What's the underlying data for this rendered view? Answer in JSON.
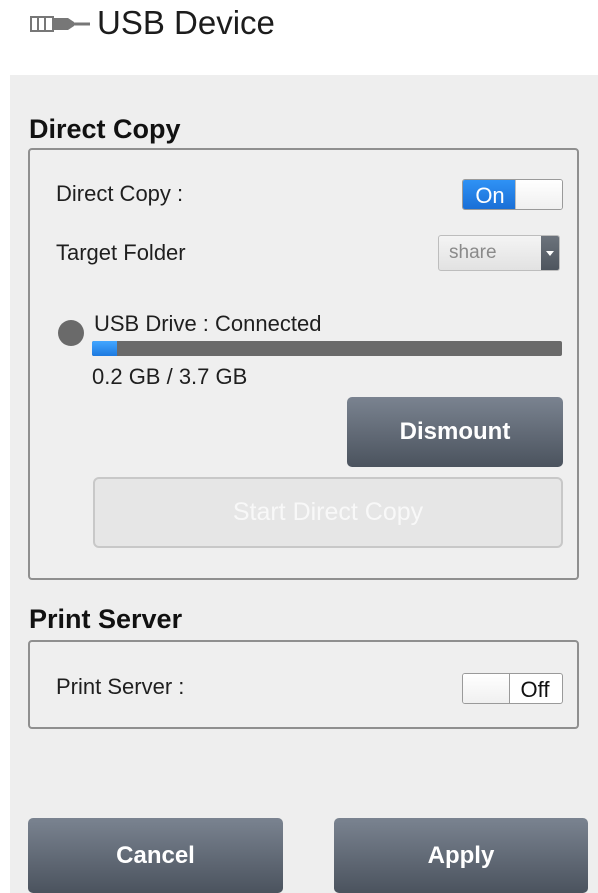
{
  "header": {
    "title": "USB Device",
    "icon": "usb-plug-icon"
  },
  "direct_copy": {
    "section_title": "Direct Copy",
    "toggle_label": "Direct Copy :",
    "toggle_state": "On",
    "target_folder_label": "Target Folder",
    "target_folder_value": "share",
    "usb_status": "USB Drive : Connected",
    "usage_text": "0.2 GB / 3.7 GB",
    "usage_fraction": 0.054,
    "dismount_label": "Dismount",
    "start_copy_label": "Start Direct Copy"
  },
  "print_server": {
    "section_title": "Print Server",
    "toggle_label": "Print Server :",
    "toggle_state": "Off"
  },
  "footer": {
    "cancel_label": "Cancel",
    "apply_label": "Apply"
  },
  "colors": {
    "accent": "#1a7be6",
    "panel_bg": "#eeeeee",
    "button_dark": "#5a626d"
  }
}
